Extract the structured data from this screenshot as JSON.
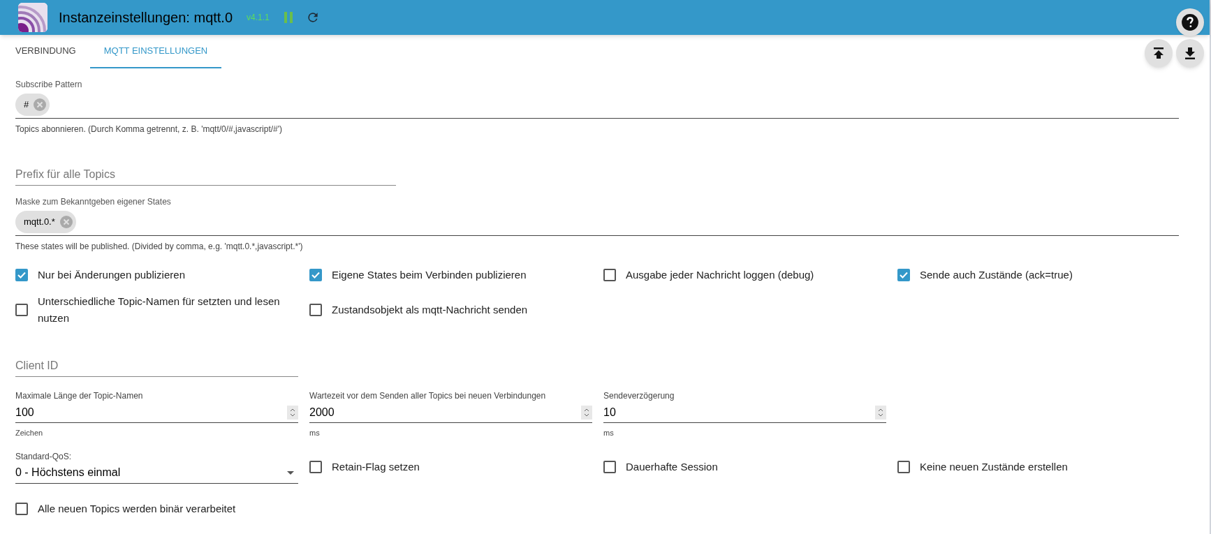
{
  "header": {
    "title": "Instanzeinstellungen: mqtt.0",
    "version": "v4.1.1"
  },
  "tabs": [
    {
      "label": "VERBINDUNG",
      "selected": false
    },
    {
      "label": "MQTT EINSTELLUNGEN",
      "selected": true
    }
  ],
  "subscribe_pattern": {
    "label": "Subscribe Pattern",
    "chips": [
      "#"
    ],
    "helper": "Topics abonnieren. (Durch Komma getrennt, z. B. 'mqtt/0/#,javascript/#')"
  },
  "prefix": {
    "placeholder": "Prefix für alle Topics"
  },
  "mask": {
    "label": "Maske zum Bekanntgeben eigener States",
    "chips": [
      "mqtt.0.*"
    ],
    "helper": "These states will be published. (Divided by comma, e.g. 'mqtt.0.*,javascript.*')"
  },
  "checkboxes_1": [
    {
      "label": "Nur bei Änderungen publizieren",
      "checked": true
    },
    {
      "label": "Eigene States beim Verbinden publizieren",
      "checked": true
    },
    {
      "label": "Ausgabe jeder Nachricht loggen (debug)",
      "checked": false
    },
    {
      "label": "Sende auch Zustände (ack=true)",
      "checked": true
    },
    {
      "label": "Unterschiedliche Topic-Namen für setzten und lesen nutzen",
      "checked": false
    },
    {
      "label": "Zustandsobjekt als mqtt-Nachricht senden",
      "checked": false
    }
  ],
  "client_id": {
    "placeholder": "Client ID"
  },
  "numbers": [
    {
      "label": "Maximale Länge der Topic-Namen",
      "value": "100",
      "unit": "Zeichen"
    },
    {
      "label": "Wartezeit vor dem Senden aller Topics bei neuen Verbindungen",
      "value": "2000",
      "unit": "ms"
    },
    {
      "label": "Sendeverzögerung",
      "value": "10",
      "unit": "ms"
    }
  ],
  "qos": {
    "label": "Standard-QoS:",
    "value": "0 - Höchstens einmal"
  },
  "checkboxes_2": [
    {
      "label": "Retain-Flag setzen",
      "checked": false
    },
    {
      "label": "Dauerhafte Session",
      "checked": false
    },
    {
      "label": "Keine neuen Zustände erstellen",
      "checked": false
    }
  ],
  "checkboxes_3": [
    {
      "label": "Alle neuen Topics werden binär verarbeitet",
      "checked": false
    }
  ]
}
